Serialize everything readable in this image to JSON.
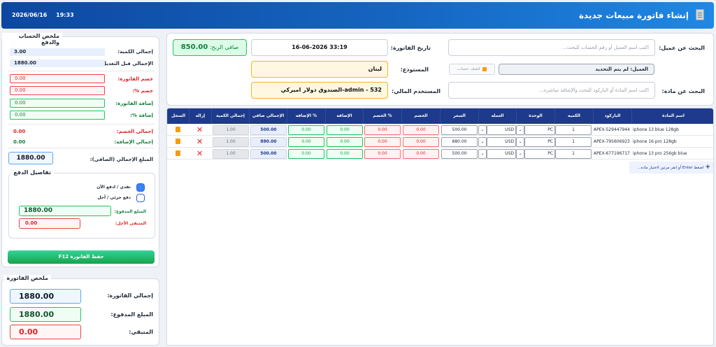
{
  "header": {
    "title": "إنشاء فاتورة مبيعات جديدة",
    "date": "2026/06/16",
    "time": "19:33"
  },
  "form": {
    "customer_search_label": "البحث عن عميل:",
    "customer_search_placeholder": "اكتب اسم العميل أو رقم الحساب للبحث...",
    "customer_label": "العميل: لم يتم التحديد",
    "account_statement_button": "كشف حساب",
    "invoice_date_label": "تاريخ الفاتورة:",
    "invoice_date_value": "16-06-2026 33:19",
    "warehouse_label": "المستودع:",
    "warehouse_value": "لبنان",
    "item_search_label": "البحث عن مادة:",
    "item_search_placeholder": "اكتب اسم المادة أو الباركود للبحث والإضافة مباشرة...",
    "fin_user_label": "المستخدم المالي:",
    "fin_user_value": "532 - admin-الصندوق دولار اميركي",
    "net_profit_label": "صافي الربح:",
    "net_profit_value": "850.00"
  },
  "table": {
    "headers": [
      "اسم المادة",
      "الباركود",
      "الكميه",
      "الوحدة",
      "العمله",
      "السعر",
      "الخصم",
      "الخصم %",
      "الإضافه",
      "الإضافه %",
      "الإجمالي صافي",
      "إجمالي الكمية",
      "إزاله",
      "السجل"
    ],
    "rows": [
      {
        "name": "iphone 13 blue 128gb",
        "barcode": "APEX-529447944",
        "qty": "1",
        "unit": "PC",
        "currency": "USD",
        "price": "500.00",
        "disc": "0.00",
        "disc_pct": "0.00",
        "add": "0.00",
        "add_pct": "0.00",
        "net": "500.00",
        "total_qty": "1.00"
      },
      {
        "name": "iphone 16 pro 128gb",
        "barcode": "APEX-795606923",
        "qty": "1",
        "unit": "PC",
        "currency": "USD",
        "price": "880.00",
        "disc": "0.00",
        "disc_pct": "0.00",
        "add": "0.00",
        "add_pct": "0.00",
        "net": "880.00",
        "total_qty": "1.00"
      },
      {
        "name": "iphone 13 pro 256gb blue",
        "barcode": "APEX-677196717",
        "qty": "1",
        "unit": "PC",
        "currency": "USD",
        "price": "500.00",
        "disc": "0.00",
        "disc_pct": "0.00",
        "add": "0.00",
        "add_pct": "0.00",
        "net": "500.00",
        "total_qty": "1.00"
      }
    ],
    "add_hint": "اضغط Enter أو انقر مرتين لاختيار ماده..."
  },
  "side": {
    "title": "ملخص الحساب والدفع",
    "total_qty_label": "إجمالي الكمية:",
    "total_qty": "3.00",
    "total_before_label": "الإجمالي قبل التعديل:",
    "total_before": "1880.00",
    "inv_disc_label": "خصم الفاتورة:",
    "inv_disc": "0.00",
    "disc_pct_label": "خصم %:",
    "disc_pct": "0.00",
    "inv_add_label": "إضافة الفاتورة:",
    "inv_add": "0.00",
    "add_pct_label": "إضافة %:",
    "add_pct": "0.00",
    "total_disc_label": "إجمالي الخصم:",
    "total_disc": "0.00",
    "total_add_label": "إجمالي الإضافة:",
    "total_add": "0.00",
    "grand_label": "المبلغ الإجمالي (الصافي):",
    "grand": "1880.00",
    "pay_title": "تفاصيل الدفع",
    "cash_label": "نقدي / ادفع الآن",
    "credit_label": "دفع جزئي / آجل",
    "paid_label": "المبلغ المدفوع:",
    "paid": "1880.00",
    "remain_label": "المتبقي الأجل:",
    "remain": "0.00",
    "save_button": "حفظ الفاتورة F12"
  },
  "summary": {
    "title": "ملخص الفاتورة",
    "total_label": "إجمالي الفاتورة:",
    "total": "1880.00",
    "paid_label": "المبلغ المدفوع:",
    "paid": "1880.00",
    "remain_label": "المتبقي:",
    "remain": "0.00"
  },
  "colors": {
    "accent": "#1565c0",
    "table_header": "#1e3a8a",
    "save": "#16a34a",
    "danger": "#dc2626"
  }
}
